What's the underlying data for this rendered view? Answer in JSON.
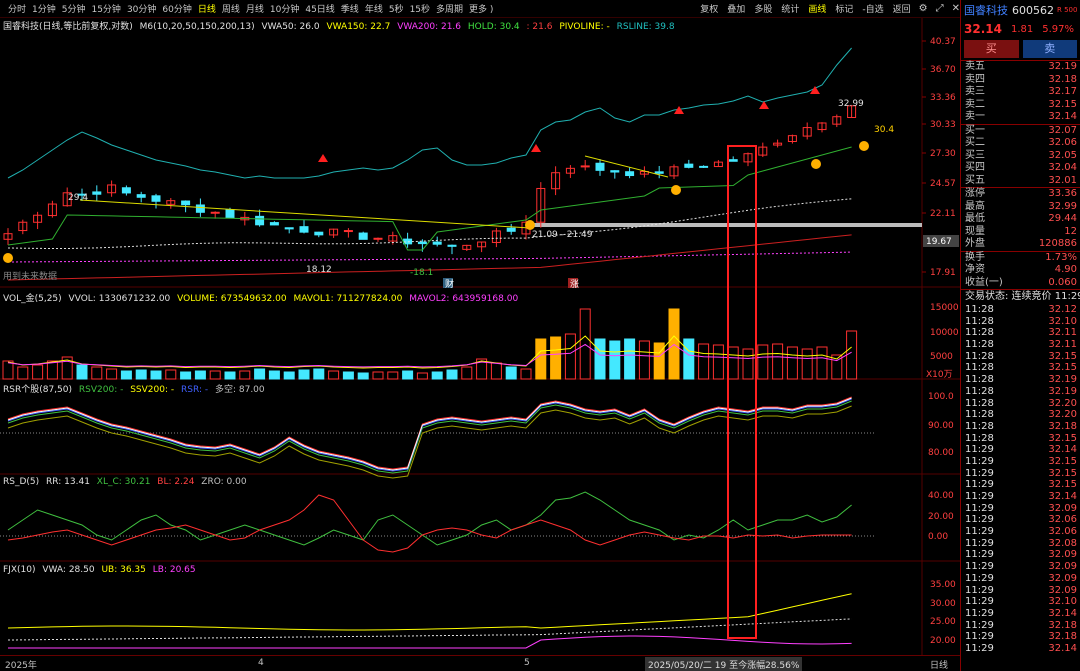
{
  "toolbar": {
    "periods": [
      "分时",
      "1分钟",
      "5分钟",
      "15分钟",
      "30分钟",
      "60分钟",
      "日线",
      "周线",
      "月线",
      "10分钟",
      "45日线",
      "季线",
      "年线",
      "5秒",
      "15秒",
      "多周期",
      "更多 )"
    ],
    "active_period": "日线",
    "right_items": [
      "复权",
      "叠加",
      "多股",
      "统计",
      "画线",
      "标记",
      "-自选",
      "返回"
    ],
    "active_right": "画线"
  },
  "main_chart": {
    "title": "国睿科技(日线,等比前复权,对数)",
    "ma_label": "M6(10,20,50,150,200,13)",
    "vwa50": "VWA50: 26.0",
    "vwa150": "VWA150: 22.7",
    "vwa200": "VWA200: 21.6",
    "hold": "HOLD: 30.4",
    "hold2": ": 21.6",
    "pivoline": "PIVOLINE: -",
    "rsline": "RSLINE: 39.8",
    "y_ticks": [
      "40.37",
      "36.70",
      "33.36",
      "30.33",
      "27.30",
      "24.57",
      "22.11",
      "19.67",
      "17.91"
    ],
    "current_price_tag": "19.67",
    "annotations": {
      "high_left": "29.4",
      "low1": "18.12",
      "low2": "-18.1",
      "range_label": "21.09 - 21.49",
      "high_right": "32.99",
      "hold_value": "30.4",
      "note": "用到未来数据",
      "marker_cai": "财",
      "marker_zhang": "涨"
    }
  },
  "vol_chart": {
    "title": "VOL_金(5,25)",
    "vvol": "VVOL: 1330671232.00",
    "volume": "VOLUME: 673549632.00",
    "mavol1": "MAVOL1: 711277824.00",
    "mavol2": "MAVOL2: 643959168.00",
    "y_ticks": [
      "15000",
      "10000",
      "5000"
    ],
    "unit": "X10万"
  },
  "rsr_chart": {
    "title": "RSR个股(87,50)",
    "rsv200": "RSV200: -",
    "ssv200": "SSV200: -",
    "rsr": "RSR: -",
    "duokong": "多空: 87.00",
    "y_ticks": [
      "100.0",
      "90.00",
      "80.00"
    ]
  },
  "rsd_chart": {
    "title": "RS_D(5)",
    "rr": "RR: 13.41",
    "xl_c": "XL_C: 30.21",
    "bl": "BL: 2.24",
    "zro": "ZRO: 0.00",
    "y_ticks": [
      "40.00",
      "20.00",
      "0.00"
    ]
  },
  "fjx_chart": {
    "title": "FJX(10)",
    "vwa": "VWA: 28.50",
    "ub": "UB: 36.35",
    "lb": "LB: 20.65",
    "y_ticks": [
      "35.00",
      "30.00",
      "25.00",
      "20.00"
    ]
  },
  "bottom_axis": {
    "labels": [
      "2025年",
      "4",
      "5"
    ],
    "date_box": "2025/05/20/二 19 至今涨幅28.56%",
    "period": "日线"
  },
  "quote": {
    "name": "国睿科技",
    "code": "600562",
    "price": "32.14",
    "change": "1.81",
    "pct": "5.97%",
    "buy_label": "买",
    "sell_label": "卖",
    "badge": "R 500",
    "asks": [
      {
        "label": "卖五",
        "price": "32.19"
      },
      {
        "label": "卖四",
        "price": "32.18"
      },
      {
        "label": "卖三",
        "price": "32.17"
      },
      {
        "label": "卖二",
        "price": "32.15"
      },
      {
        "label": "卖一",
        "price": "32.14"
      }
    ],
    "bids": [
      {
        "label": "买一",
        "price": "32.07"
      },
      {
        "label": "买二",
        "price": "32.06"
      },
      {
        "label": "买三",
        "price": "32.05"
      },
      {
        "label": "买四",
        "price": "32.04"
      },
      {
        "label": "买五",
        "price": "32.01"
      }
    ],
    "stats": [
      {
        "label": "涨停",
        "value": "33.36"
      },
      {
        "label": "最高",
        "value": "32.99"
      },
      {
        "label": "最低",
        "value": "29.44"
      },
      {
        "label": "现量",
        "value": "12"
      },
      {
        "label": "外盘",
        "value": "120886"
      }
    ],
    "stats2": [
      {
        "label": "换手",
        "value": "1.73%"
      },
      {
        "label": "净资",
        "value": "4.90"
      },
      {
        "label": "收益(一)",
        "value": "0.060"
      }
    ],
    "trade_status": "交易状态: 连续竞价 11:29",
    "ticks": [
      {
        "t": "11:28",
        "p": "32.12"
      },
      {
        "t": "11:28",
        "p": "32.10"
      },
      {
        "t": "11:28",
        "p": "32.11"
      },
      {
        "t": "11:28",
        "p": "32.11"
      },
      {
        "t": "11:28",
        "p": "32.15"
      },
      {
        "t": "11:28",
        "p": "32.15"
      },
      {
        "t": "11:28",
        "p": "32.19"
      },
      {
        "t": "11:28",
        "p": "32.19"
      },
      {
        "t": "11:28",
        "p": "32.20"
      },
      {
        "t": "11:28",
        "p": "32.20"
      },
      {
        "t": "11:28",
        "p": "32.18"
      },
      {
        "t": "11:28",
        "p": "32.15"
      },
      {
        "t": "11:29",
        "p": "32.14"
      },
      {
        "t": "11:29",
        "p": "32.15"
      },
      {
        "t": "11:29",
        "p": "32.15"
      },
      {
        "t": "11:29",
        "p": "32.15"
      },
      {
        "t": "11:29",
        "p": "32.14"
      },
      {
        "t": "11:29",
        "p": "32.09"
      },
      {
        "t": "11:29",
        "p": "32.06"
      },
      {
        "t": "11:29",
        "p": "32.06"
      },
      {
        "t": "11:29",
        "p": "32.08"
      },
      {
        "t": "11:29",
        "p": "32.09"
      },
      {
        "t": "11:29",
        "p": "32.09"
      },
      {
        "t": "11:29",
        "p": "32.09"
      },
      {
        "t": "11:29",
        "p": "32.09"
      },
      {
        "t": "11:29",
        "p": "32.10"
      },
      {
        "t": "11:29",
        "p": "32.14"
      },
      {
        "t": "11:29",
        "p": "32.18"
      },
      {
        "t": "11:29",
        "p": "32.18"
      },
      {
        "t": "11:29",
        "p": "32.14"
      }
    ]
  },
  "colors": {
    "up": "#ff3030",
    "down": "#44e8ff",
    "yellow": "#ffff00",
    "green": "#40c040",
    "magenta": "#ff40ff",
    "white": "#e0e0e0",
    "orange": "#ffb000"
  }
}
